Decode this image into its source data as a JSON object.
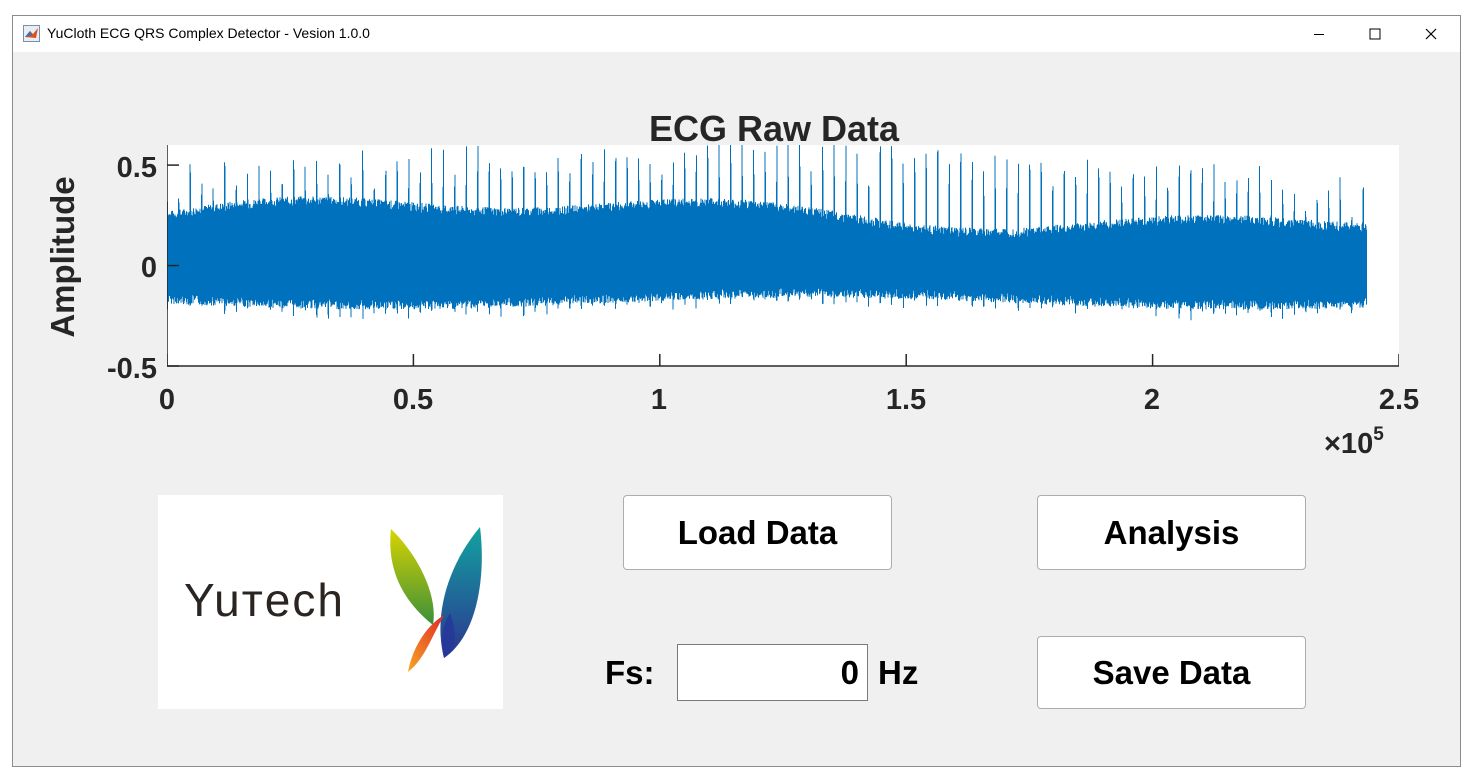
{
  "window": {
    "title": "YuCloth ECG QRS Complex Detector - Vesion 1.0.0",
    "controls": {
      "minimize_icon": "minimize-icon",
      "maximize_icon": "maximize-icon",
      "close_icon": "close-icon"
    }
  },
  "plot": {
    "title": "ECG Raw Data",
    "ylabel": "Amplitude",
    "y_ticks": [
      "0.5",
      "0",
      "-0.5"
    ],
    "x_ticks": [
      "0",
      "0.5",
      "1",
      "1.5",
      "2",
      "2.5"
    ],
    "x_exponent_base": "×10",
    "x_exponent_power": "5",
    "line_color": "#0072bd"
  },
  "chart_data": {
    "type": "line",
    "title": "ECG Raw Data",
    "xlabel": "",
    "ylabel": "Amplitude",
    "xlim": [
      0,
      250000
    ],
    "ylim": [
      -0.5,
      0.6
    ],
    "x_scale_note": "×10^5",
    "grid": false,
    "series": [
      {
        "x_range": [
          0,
          243500
        ],
        "y_approx_range": [
          -0.33,
          0.61
        ]
      }
    ]
  },
  "logo": {
    "text": "Yuтech"
  },
  "buttons": {
    "load": "Load Data",
    "analysis": "Analysis",
    "save": "Save Data"
  },
  "fs": {
    "label": "Fs:",
    "value": "0",
    "unit": "Hz"
  }
}
